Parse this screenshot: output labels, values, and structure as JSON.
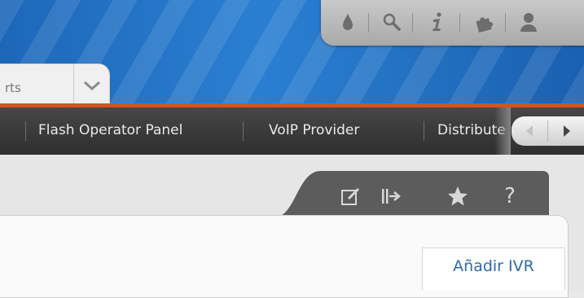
{
  "header": {
    "icons": [
      "water-drop-icon",
      "search-icon",
      "info-icon",
      "puzzle-icon",
      "user-icon"
    ],
    "module_selector": {
      "label": "rts"
    }
  },
  "nav": {
    "items": [
      "Flash Operator Panel",
      "VoIP Provider",
      "Distribute"
    ]
  },
  "toolbar": {
    "actions": [
      "edit-icon",
      "logout-icon",
      "star-icon",
      "help-icon"
    ],
    "help_glyph": "?"
  },
  "content": {
    "add_button_label": "Añadir IVR"
  },
  "colors": {
    "accent": "#d4531e",
    "link": "#2f6aa5",
    "nav_bg": "#3a3a3a"
  }
}
